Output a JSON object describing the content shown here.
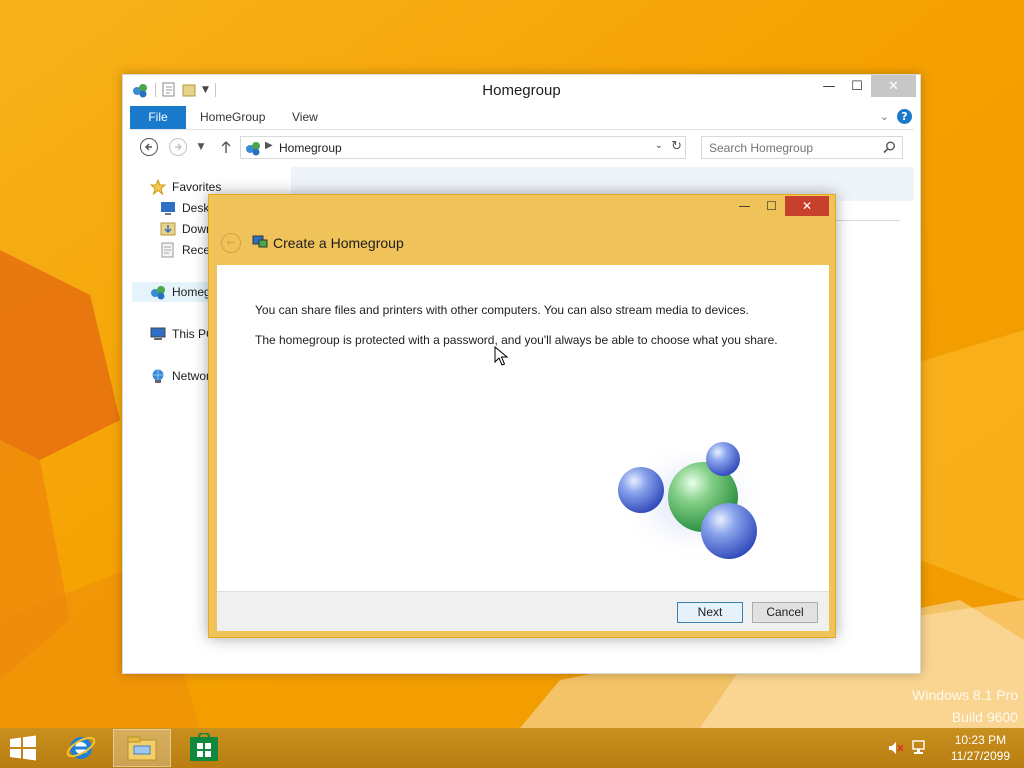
{
  "explorer": {
    "title": "Homegroup",
    "ribbon_tabs": {
      "file": "File",
      "homegroup": "HomeGroup",
      "view": "View"
    },
    "address": "Homegroup",
    "search_placeholder": "Search Homegroup",
    "nav": {
      "favorites": "Favorites",
      "desktop": "Desktop",
      "downloads": "Downloads",
      "recent": "Recent places",
      "homegroup": "Homegroup",
      "this_pc": "This PC",
      "network": "Network"
    }
  },
  "dialog": {
    "title": "Create a Homegroup",
    "line1": "You can share files and printers with other computers. You can also stream media to devices.",
    "line2": "The homegroup is protected with a password, and you'll always be able to choose what you share.",
    "next_label": "Next",
    "cancel_label": "Cancel"
  },
  "watermark": {
    "line1": "Windows 8.1 Pro",
    "line2": "Build 9600"
  },
  "taskbar": {
    "time": "10:23 PM",
    "date": "11/27/2099",
    "pinned": [
      "internet-explorer-icon",
      "file-explorer-icon",
      "store-icon"
    ]
  },
  "colors": {
    "desktop": "#f5a400",
    "dialog_frame": "#f0c35a",
    "accent_blue": "#1979ca",
    "close_red": "#c7402c"
  }
}
